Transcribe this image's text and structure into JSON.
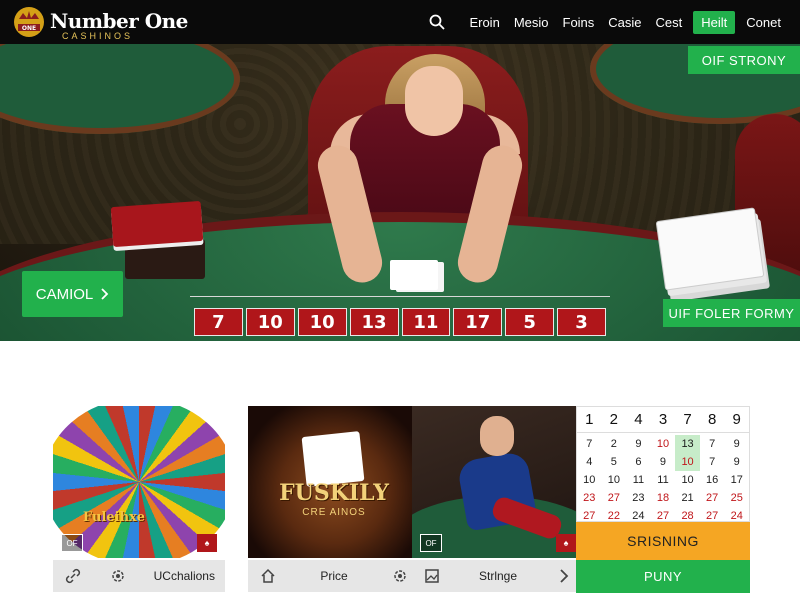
{
  "header": {
    "logo_title": "Number One",
    "logo_subtitle": "CASHINOS",
    "logo_badge_text": "ONE",
    "nav": [
      "Eroin",
      "Mesio",
      "Foins",
      "Casie",
      "Cest",
      "Heilt",
      "Conet"
    ],
    "active_nav": "Heilt"
  },
  "hero": {
    "main_button_label": "CAMIOL",
    "main_button_icon": "chevron-right-icon",
    "badge_top_right": "OIF STRONY",
    "badge_bottom_right": "UIF FOLER FORMY",
    "chip_numbers": [
      "7",
      "10",
      "10",
      "13",
      "11",
      "17",
      "5",
      "3"
    ]
  },
  "cards": [
    {
      "image_text": "Fuleihxe",
      "footer_icons": [
        "link-icon",
        "gear-icon"
      ],
      "footer_label": "UCchalions",
      "badge_left": "OF"
    },
    {
      "image_title": "FUSKILY",
      "image_subtitle": "CRE AINOS",
      "footer_icons": [
        "home-icon",
        "gear-icon"
      ],
      "footer_label": "Price"
    },
    {
      "footer_icons": [
        "image-icon",
        "chevron-right-icon"
      ],
      "footer_label": "Strlnge",
      "badge_left": "OF"
    }
  ],
  "calendar": {
    "header": [
      "1",
      "2",
      "4",
      "3",
      "7",
      "8",
      "9"
    ],
    "rows": [
      [
        "7",
        "2",
        "9",
        "10",
        "13",
        "7",
        "9"
      ],
      [
        "4",
        "5",
        "6",
        "9",
        "10",
        "7",
        "9"
      ],
      [
        "10",
        "10",
        "11",
        "11",
        "10",
        "16",
        "17"
      ],
      [
        "23",
        "27",
        "23",
        "18",
        "21",
        "27",
        "25"
      ],
      [
        "27",
        "22",
        "24",
        "27",
        "28",
        "27",
        "24"
      ]
    ]
  },
  "side_buttons": {
    "orange_label": "SRISNING",
    "green_label": "PUNY"
  },
  "colors": {
    "accent_green": "#22b14c",
    "accent_orange": "#f5a623",
    "header_bg": "#0a0a0a",
    "chip_red": "#b0161a"
  }
}
